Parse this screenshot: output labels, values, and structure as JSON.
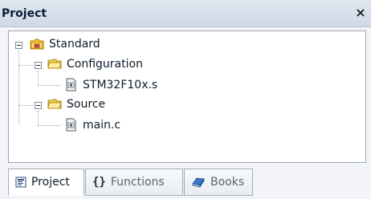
{
  "window": {
    "title": "Project",
    "close_label": "×"
  },
  "tree": {
    "root": {
      "label": "Standard",
      "icon": "folder-root-icon"
    },
    "items": [
      {
        "label": "Configuration",
        "icon": "folder-open-icon"
      },
      {
        "label": "STM32F10x.s",
        "icon": "file-icon"
      },
      {
        "label": "Source",
        "icon": "folder-open-icon"
      },
      {
        "label": "main.c",
        "icon": "file-icon"
      }
    ]
  },
  "tabs": [
    {
      "label": "Project",
      "icon": "project-tab-icon",
      "active": true
    },
    {
      "label": "Functions",
      "icon": "braces-icon",
      "active": false
    },
    {
      "label": "Books",
      "icon": "books-icon",
      "active": false
    }
  ],
  "braces_glyph": "{}",
  "colors": {
    "title_bar": "#cfd9e6",
    "tree_bg": "#ffffff",
    "tab_active_bg": "#ffffff",
    "tab_inactive_text": "#5c6670"
  }
}
